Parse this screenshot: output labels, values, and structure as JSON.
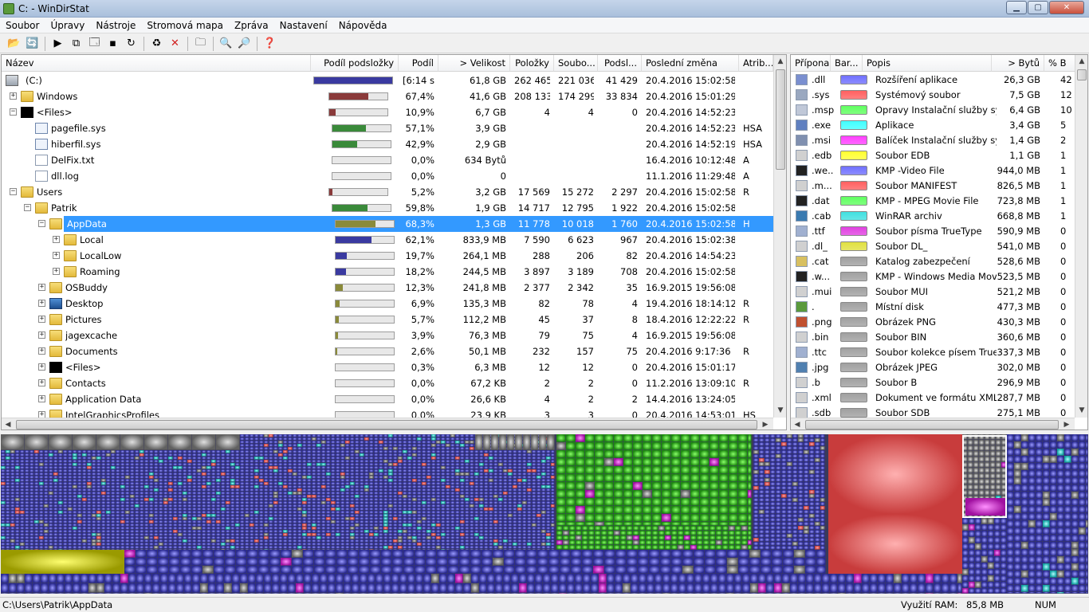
{
  "window": {
    "title": "C: - WinDirStat"
  },
  "menu": [
    "Soubor",
    "Úpravy",
    "Nástroje",
    "Stromová mapa",
    "Zpráva",
    "Nastavení",
    "Nápověda"
  ],
  "toolbar": [
    {
      "icon": "open-folder-icon",
      "glyph": "📂"
    },
    {
      "icon": "refresh-all-icon",
      "glyph": "🔄"
    },
    {
      "sep": true
    },
    {
      "icon": "play-icon",
      "glyph": "▶"
    },
    {
      "icon": "copy-icon",
      "glyph": "⧉"
    },
    {
      "icon": "explorer-icon",
      "glyph": "🗔"
    },
    {
      "icon": "command-prompt-icon",
      "glyph": "▪"
    },
    {
      "icon": "refresh-icon",
      "glyph": "↻"
    },
    {
      "sep": true
    },
    {
      "icon": "recycle-icon",
      "glyph": "♻"
    },
    {
      "icon": "delete-icon",
      "glyph": "✕",
      "color": "#d12020"
    },
    {
      "sep": true
    },
    {
      "icon": "new-folder-icon",
      "glyph": "🗀"
    },
    {
      "sep": true
    },
    {
      "icon": "zoom-in-icon",
      "glyph": "🔍"
    },
    {
      "icon": "zoom-out-icon",
      "glyph": "🔎"
    },
    {
      "sep": true
    },
    {
      "icon": "help-icon",
      "glyph": "❓"
    }
  ],
  "tree": {
    "columns": [
      "Název",
      "Podíl podsložky",
      "Podíl",
      "> Velikost",
      "Položky",
      "Soubo...",
      "Podsl...",
      "Poslední změna",
      "Atrib..."
    ],
    "rows": [
      {
        "level": 0,
        "exp": "",
        "icon": "drive",
        "name": "(C:)",
        "fill": 1.0,
        "color": "#3a3aa0",
        "share": "[6:14 s]",
        "size": "61,8 GB",
        "items": "262 465",
        "files": "221 036",
        "dirs": "41 429",
        "date": "20.4.2016  15:02:58",
        "attr": ""
      },
      {
        "level": 0,
        "exp": "+",
        "icon": "folder",
        "name": "Windows",
        "fill": 0.674,
        "color": "#8a3a3a",
        "share": "67,4%",
        "size": "41,6 GB",
        "items": "208 133",
        "files": "174 299",
        "dirs": "33 834",
        "date": "20.4.2016  15:01:29",
        "attr": ""
      },
      {
        "level": 0,
        "exp": "−",
        "icon": "black",
        "name": "<Files>",
        "fill": 0.109,
        "color": "#8a3a3a",
        "share": "10,9%",
        "size": "6,7 GB",
        "items": "4",
        "files": "4",
        "dirs": "0",
        "date": "20.4.2016  14:52:23",
        "attr": ""
      },
      {
        "level": 1,
        "exp": "",
        "icon": "sys",
        "name": "pagefile.sys",
        "fill": 0.571,
        "color": "#3a8a3a",
        "share": "57,1%",
        "size": "3,9 GB",
        "items": "",
        "files": "",
        "dirs": "",
        "date": "20.4.2016  14:52:23",
        "attr": "HSA"
      },
      {
        "level": 1,
        "exp": "",
        "icon": "sys",
        "name": "hiberfil.sys",
        "fill": 0.429,
        "color": "#3a8a3a",
        "share": "42,9%",
        "size": "2,9 GB",
        "items": "",
        "files": "",
        "dirs": "",
        "date": "20.4.2016  14:52:19",
        "attr": "HSA"
      },
      {
        "level": 1,
        "exp": "",
        "icon": "file",
        "name": "DelFix.txt",
        "fill": 0.0,
        "color": "#3a8a3a",
        "share": "0,0%",
        "size": "634 Bytů",
        "items": "",
        "files": "",
        "dirs": "",
        "date": "16.4.2016  10:12:48",
        "attr": "A"
      },
      {
        "level": 1,
        "exp": "",
        "icon": "file",
        "name": "dll.log",
        "fill": 0.0,
        "color": "#3a8a3a",
        "share": "0,0%",
        "size": "0",
        "items": "",
        "files": "",
        "dirs": "",
        "date": "11.1.2016  11:29:48",
        "attr": "A"
      },
      {
        "level": 0,
        "exp": "−",
        "icon": "folder",
        "name": "Users",
        "fill": 0.052,
        "color": "#8a3a3a",
        "share": "5,2%",
        "size": "3,2 GB",
        "items": "17 569",
        "files": "15 272",
        "dirs": "2 297",
        "date": "20.4.2016  15:02:58",
        "attr": "R"
      },
      {
        "level": 1,
        "exp": "−",
        "icon": "folder",
        "name": "Patrik",
        "fill": 0.598,
        "color": "#3a8a3a",
        "share": "59,8%",
        "size": "1,9 GB",
        "items": "14 717",
        "files": "12 795",
        "dirs": "1 922",
        "date": "20.4.2016  15:02:58",
        "attr": ""
      },
      {
        "level": 2,
        "exp": "−",
        "icon": "folder",
        "name": "AppData",
        "fill": 0.683,
        "color": "#8a8a3a",
        "share": "68,3%",
        "size": "1,3 GB",
        "items": "11 778",
        "files": "10 018",
        "dirs": "1 760",
        "date": "20.4.2016  15:02:58",
        "attr": "H",
        "selected": true
      },
      {
        "level": 3,
        "exp": "+",
        "icon": "folder",
        "name": "Local",
        "fill": 0.621,
        "color": "#3a3aa0",
        "share": "62,1%",
        "size": "833,9 MB",
        "items": "7 590",
        "files": "6 623",
        "dirs": "967",
        "date": "20.4.2016  15:02:38",
        "attr": ""
      },
      {
        "level": 3,
        "exp": "+",
        "icon": "folder",
        "name": "LocalLow",
        "fill": 0.197,
        "color": "#3a3aa0",
        "share": "19,7%",
        "size": "264,1 MB",
        "items": "288",
        "files": "206",
        "dirs": "82",
        "date": "20.4.2016  14:54:23",
        "attr": ""
      },
      {
        "level": 3,
        "exp": "+",
        "icon": "folder",
        "name": "Roaming",
        "fill": 0.182,
        "color": "#3a3aa0",
        "share": "18,2%",
        "size": "244,5 MB",
        "items": "3 897",
        "files": "3 189",
        "dirs": "708",
        "date": "20.4.2016  15:02:58",
        "attr": ""
      },
      {
        "level": 2,
        "exp": "+",
        "icon": "folder",
        "name": "OSBuddy",
        "fill": 0.123,
        "color": "#8a8a3a",
        "share": "12,3%",
        "size": "241,8 MB",
        "items": "2 377",
        "files": "2 342",
        "dirs": "35",
        "date": "16.9.2015  19:56:08",
        "attr": ""
      },
      {
        "level": 2,
        "exp": "+",
        "icon": "desktop",
        "name": "Desktop",
        "fill": 0.069,
        "color": "#8a8a3a",
        "share": "6,9%",
        "size": "135,3 MB",
        "items": "82",
        "files": "78",
        "dirs": "4",
        "date": "19.4.2016  18:14:12",
        "attr": "R"
      },
      {
        "level": 2,
        "exp": "+",
        "icon": "folder",
        "name": "Pictures",
        "fill": 0.057,
        "color": "#8a8a3a",
        "share": "5,7%",
        "size": "112,2 MB",
        "items": "45",
        "files": "37",
        "dirs": "8",
        "date": "18.4.2016  12:22:22",
        "attr": "R"
      },
      {
        "level": 2,
        "exp": "+",
        "icon": "folder",
        "name": "jagexcache",
        "fill": 0.039,
        "color": "#8a8a3a",
        "share": "3,9%",
        "size": "76,3 MB",
        "items": "79",
        "files": "75",
        "dirs": "4",
        "date": "16.9.2015  19:56:08",
        "attr": ""
      },
      {
        "level": 2,
        "exp": "+",
        "icon": "folder",
        "name": "Documents",
        "fill": 0.026,
        "color": "#8a8a3a",
        "share": "2,6%",
        "size": "50,1 MB",
        "items": "232",
        "files": "157",
        "dirs": "75",
        "date": "20.4.2016  9:17:36",
        "attr": "R"
      },
      {
        "level": 2,
        "exp": "+",
        "icon": "black",
        "name": "<Files>",
        "fill": 0.003,
        "color": "#8a8a3a",
        "share": "0,3%",
        "size": "6,3 MB",
        "items": "12",
        "files": "12",
        "dirs": "0",
        "date": "20.4.2016  15:01:17",
        "attr": ""
      },
      {
        "level": 2,
        "exp": "+",
        "icon": "folder",
        "name": "Contacts",
        "fill": 0.0,
        "color": "#8a8a3a",
        "share": "0,0%",
        "size": "67,2 KB",
        "items": "2",
        "files": "2",
        "dirs": "0",
        "date": "11.2.2016  13:09:10",
        "attr": "R"
      },
      {
        "level": 2,
        "exp": "+",
        "icon": "folder",
        "name": "Application Data",
        "fill": 0.0,
        "color": "#8a8a3a",
        "share": "0,0%",
        "size": "26,6 KB",
        "items": "4",
        "files": "2",
        "dirs": "2",
        "date": "14.4.2016  13:24:05",
        "attr": ""
      },
      {
        "level": 2,
        "exp": "+",
        "icon": "folder",
        "name": "IntelGraphicsProfiles",
        "fill": 0.0,
        "color": "#8a8a3a",
        "share": "0,0%",
        "size": "23,9 KB",
        "items": "3",
        "files": "3",
        "dirs": "0",
        "date": "20.4.2016  14:53:01",
        "attr": "HS"
      }
    ]
  },
  "ext": {
    "columns": [
      "Přípona",
      "Bar...",
      "Popis",
      "> Bytů",
      "% B"
    ],
    "rows": [
      {
        "ext": ".dll",
        "color": "#7070ff",
        "desc": "Rozšíření aplikace",
        "bytes": "26,3 GB",
        "pct": "42"
      },
      {
        "ext": ".sys",
        "color": "#ff6060",
        "desc": "Systémový soubor",
        "bytes": "7,5 GB",
        "pct": "12"
      },
      {
        "ext": ".msp",
        "color": "#60ff60",
        "desc": "Opravy Instalační služby sys...",
        "bytes": "6,4 GB",
        "pct": "10"
      },
      {
        "ext": ".exe",
        "color": "#40ffff",
        "desc": "Aplikace",
        "bytes": "3,4 GB",
        "pct": "5"
      },
      {
        "ext": ".msi",
        "color": "#ff40ff",
        "desc": "Balíček Instalační služby syst...",
        "bytes": "1,4 GB",
        "pct": "2"
      },
      {
        "ext": ".edb",
        "color": "#ffff30",
        "desc": "Soubor EDB",
        "bytes": "1,1 GB",
        "pct": "1"
      },
      {
        "ext": ".we...",
        "color": "#7070ff",
        "desc": "KMP -Video File",
        "bytes": "944,0 MB",
        "pct": "1"
      },
      {
        "ext": ".m...",
        "color": "#ff6060",
        "desc": "Soubor MANIFEST",
        "bytes": "826,5 MB",
        "pct": "1"
      },
      {
        "ext": ".dat",
        "color": "#60ff60",
        "desc": "KMP - MPEG Movie File",
        "bytes": "723,8 MB",
        "pct": "1"
      },
      {
        "ext": ".cab",
        "color": "#40e0e0",
        "desc": "WinRAR archiv",
        "bytes": "668,8 MB",
        "pct": "1"
      },
      {
        "ext": ".ttf",
        "color": "#e040e0",
        "desc": "Soubor písma TrueType",
        "bytes": "590,9 MB",
        "pct": "0"
      },
      {
        "ext": ".dl_",
        "color": "#e0e040",
        "desc": "Soubor DL_",
        "bytes": "541,0 MB",
        "pct": "0"
      },
      {
        "ext": ".cat",
        "color": "#a0a0a0",
        "desc": "Katalog zabezpečení",
        "bytes": "528,6 MB",
        "pct": "0"
      },
      {
        "ext": ".w...",
        "color": "#a0a0a0",
        "desc": "KMP - Windows Media Mov...",
        "bytes": "523,5 MB",
        "pct": "0"
      },
      {
        "ext": ".mui",
        "color": "#a0a0a0",
        "desc": "Soubor MUI",
        "bytes": "521,2 MB",
        "pct": "0"
      },
      {
        "ext": ".",
        "color": "#a0a0a0",
        "desc": "Místní disk",
        "bytes": "477,3 MB",
        "pct": "0"
      },
      {
        "ext": ".png",
        "color": "#a0a0a0",
        "desc": "Obrázek PNG",
        "bytes": "430,3 MB",
        "pct": "0"
      },
      {
        "ext": ".bin",
        "color": "#a0a0a0",
        "desc": "Soubor BIN",
        "bytes": "360,6 MB",
        "pct": "0"
      },
      {
        "ext": ".ttc",
        "color": "#a0a0a0",
        "desc": "Soubor kolekce písem True...",
        "bytes": "337,3 MB",
        "pct": "0"
      },
      {
        "ext": ".jpg",
        "color": "#a0a0a0",
        "desc": "Obrázek JPEG",
        "bytes": "302,0 MB",
        "pct": "0"
      },
      {
        "ext": ".b",
        "color": "#a0a0a0",
        "desc": "Soubor B",
        "bytes": "296,9 MB",
        "pct": "0"
      },
      {
        "ext": ".xml",
        "color": "#a0a0a0",
        "desc": "Dokument ve formátu XML",
        "bytes": "287,7 MB",
        "pct": "0"
      },
      {
        "ext": ".sdb",
        "color": "#a0a0a0",
        "desc": "Soubor SDB",
        "bytes": "275,1 MB",
        "pct": "0"
      }
    ]
  },
  "status": {
    "path": "C:\\Users\\Patrik\\AppData",
    "ram_label": "Využití RAM:",
    "ram_value": "85,8 MB",
    "num": "NUM"
  }
}
